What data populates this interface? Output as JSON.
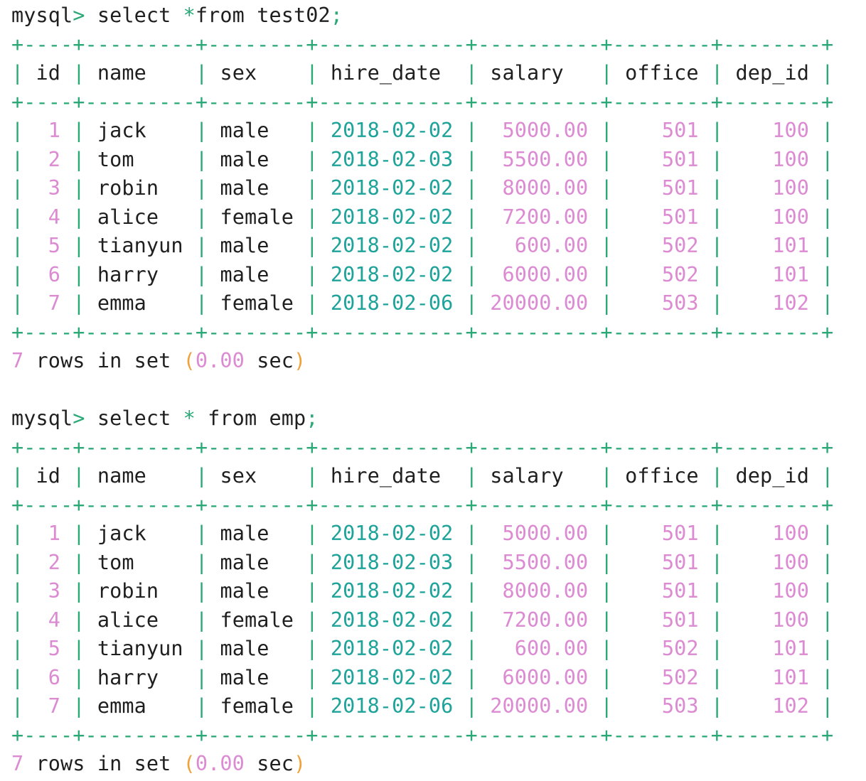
{
  "colors": {
    "text": "#1f1f1f",
    "border": "#2aa876",
    "date": "#1ea39a",
    "number": "#dc8ad2",
    "operator": "#2aa876",
    "paren": "#f0a23a"
  },
  "terminal": {
    "blocks": [
      {
        "prompt": "mysql",
        "prompt_symbol": ">",
        "query_parts": [
          {
            "text": " select ",
            "type": "plain"
          },
          {
            "text": "*",
            "type": "operator"
          },
          {
            "text": "from test02",
            "type": "plain"
          },
          {
            "text": ";",
            "type": "operator"
          }
        ],
        "columns": [
          "id",
          "name",
          "sex",
          "hire_date",
          "salary",
          "office",
          "dep_id"
        ],
        "rows": [
          [
            "1",
            "jack",
            "male",
            "2018-02-02",
            "5000.00",
            "501",
            "100"
          ],
          [
            "2",
            "tom",
            "male",
            "2018-02-03",
            "5500.00",
            "501",
            "100"
          ],
          [
            "3",
            "robin",
            "male",
            "2018-02-02",
            "8000.00",
            "501",
            "100"
          ],
          [
            "4",
            "alice",
            "female",
            "2018-02-02",
            "7200.00",
            "501",
            "100"
          ],
          [
            "5",
            "tianyun",
            "male",
            "2018-02-02",
            "600.00",
            "502",
            "101"
          ],
          [
            "6",
            "harry",
            "male",
            "2018-02-02",
            "6000.00",
            "502",
            "101"
          ],
          [
            "7",
            "emma",
            "female",
            "2018-02-06",
            "20000.00",
            "503",
            "102"
          ]
        ],
        "footer": {
          "count": "7",
          "text": " rows in set ",
          "open": "(",
          "time": "0.00",
          "unit": " sec",
          "close": ")"
        }
      },
      {
        "prompt": "mysql",
        "prompt_symbol": ">",
        "query_parts": [
          {
            "text": " select ",
            "type": "plain"
          },
          {
            "text": "*",
            "type": "operator"
          },
          {
            "text": " from emp",
            "type": "plain"
          },
          {
            "text": ";",
            "type": "operator"
          }
        ],
        "columns": [
          "id",
          "name",
          "sex",
          "hire_date",
          "salary",
          "office",
          "dep_id"
        ],
        "rows": [
          [
            "1",
            "jack",
            "male",
            "2018-02-02",
            "5000.00",
            "501",
            "100"
          ],
          [
            "2",
            "tom",
            "male",
            "2018-02-03",
            "5500.00",
            "501",
            "100"
          ],
          [
            "3",
            "robin",
            "male",
            "2018-02-02",
            "8000.00",
            "501",
            "100"
          ],
          [
            "4",
            "alice",
            "female",
            "2018-02-02",
            "7200.00",
            "501",
            "100"
          ],
          [
            "5",
            "tianyun",
            "male",
            "2018-02-02",
            "600.00",
            "502",
            "101"
          ],
          [
            "6",
            "harry",
            "male",
            "2018-02-02",
            "6000.00",
            "502",
            "101"
          ],
          [
            "7",
            "emma",
            "female",
            "2018-02-06",
            "20000.00",
            "503",
            "102"
          ]
        ],
        "footer": {
          "count": "7",
          "text": " rows in set ",
          "open": "(",
          "time": "0.00",
          "unit": " sec",
          "close": ")"
        }
      }
    ]
  }
}
